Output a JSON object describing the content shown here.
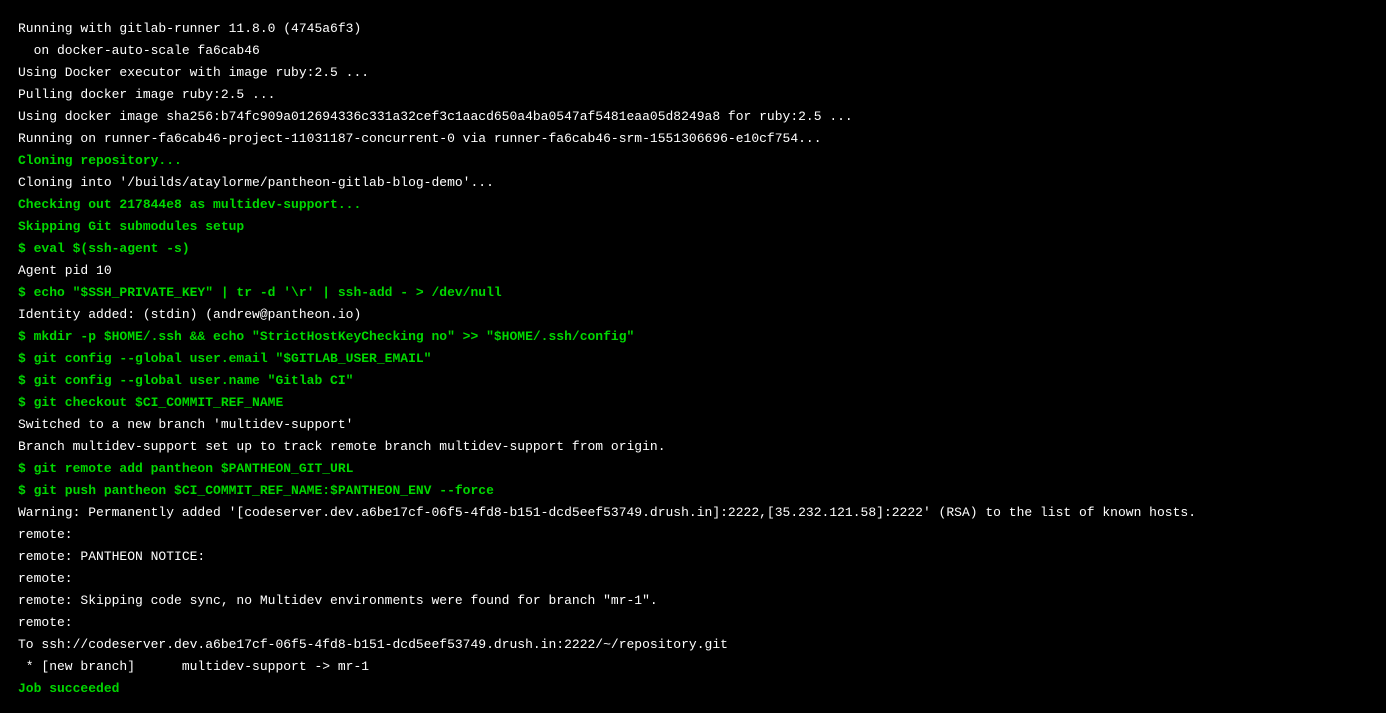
{
  "lines": [
    {
      "text": "Running with gitlab-runner 11.8.0 (4745a6f3)",
      "color": "white"
    },
    {
      "text": "  on docker-auto-scale fa6cab46",
      "color": "white"
    },
    {
      "text": "Using Docker executor with image ruby:2.5 ...",
      "color": "white"
    },
    {
      "text": "Pulling docker image ruby:2.5 ...",
      "color": "white"
    },
    {
      "text": "Using docker image sha256:b74fc909a012694336c331a32cef3c1aacd650a4ba0547af5481eaa05d8249a8 for ruby:2.5 ...",
      "color": "white"
    },
    {
      "text": "Running on runner-fa6cab46-project-11031187-concurrent-0 via runner-fa6cab46-srm-1551306696-e10cf754...",
      "color": "white"
    },
    {
      "text": "Cloning repository...",
      "color": "green"
    },
    {
      "text": "Cloning into '/builds/ataylorme/pantheon-gitlab-blog-demo'...",
      "color": "white"
    },
    {
      "text": "Checking out 217844e8 as multidev-support...",
      "color": "green"
    },
    {
      "text": "Skipping Git submodules setup",
      "color": "green"
    },
    {
      "text": "$ eval $(ssh-agent -s)",
      "color": "green"
    },
    {
      "text": "Agent pid 10",
      "color": "white"
    },
    {
      "text": "$ echo \"$SSH_PRIVATE_KEY\" | tr -d '\\r' | ssh-add - > /dev/null",
      "color": "green"
    },
    {
      "text": "Identity added: (stdin) (andrew@pantheon.io)",
      "color": "white"
    },
    {
      "text": "$ mkdir -p $HOME/.ssh && echo \"StrictHostKeyChecking no\" >> \"$HOME/.ssh/config\"",
      "color": "green"
    },
    {
      "text": "$ git config --global user.email \"$GITLAB_USER_EMAIL\"",
      "color": "green"
    },
    {
      "text": "$ git config --global user.name \"Gitlab CI\"",
      "color": "green"
    },
    {
      "text": "$ git checkout $CI_COMMIT_REF_NAME",
      "color": "green"
    },
    {
      "text": "Switched to a new branch 'multidev-support'",
      "color": "white"
    },
    {
      "text": "Branch multidev-support set up to track remote branch multidev-support from origin.",
      "color": "white"
    },
    {
      "text": "$ git remote add pantheon $PANTHEON_GIT_URL",
      "color": "green"
    },
    {
      "text": "$ git push pantheon $CI_COMMIT_REF_NAME:$PANTHEON_ENV --force",
      "color": "green"
    },
    {
      "text": "Warning: Permanently added '[codeserver.dev.a6be17cf-06f5-4fd8-b151-dcd5eef53749.drush.in]:2222,[35.232.121.58]:2222' (RSA) to the list of known hosts.",
      "color": "white"
    },
    {
      "text": "remote:",
      "color": "white"
    },
    {
      "text": "remote: PANTHEON NOTICE:",
      "color": "white"
    },
    {
      "text": "remote:",
      "color": "white"
    },
    {
      "text": "remote: Skipping code sync, no Multidev environments were found for branch \"mr-1\".",
      "color": "white"
    },
    {
      "text": "remote:",
      "color": "white"
    },
    {
      "text": "To ssh://codeserver.dev.a6be17cf-06f5-4fd8-b151-dcd5eef53749.drush.in:2222/~/repository.git",
      "color": "white"
    },
    {
      "text": " * [new branch]      multidev-support -> mr-1",
      "color": "white"
    },
    {
      "text": "Job succeeded",
      "color": "green"
    }
  ]
}
